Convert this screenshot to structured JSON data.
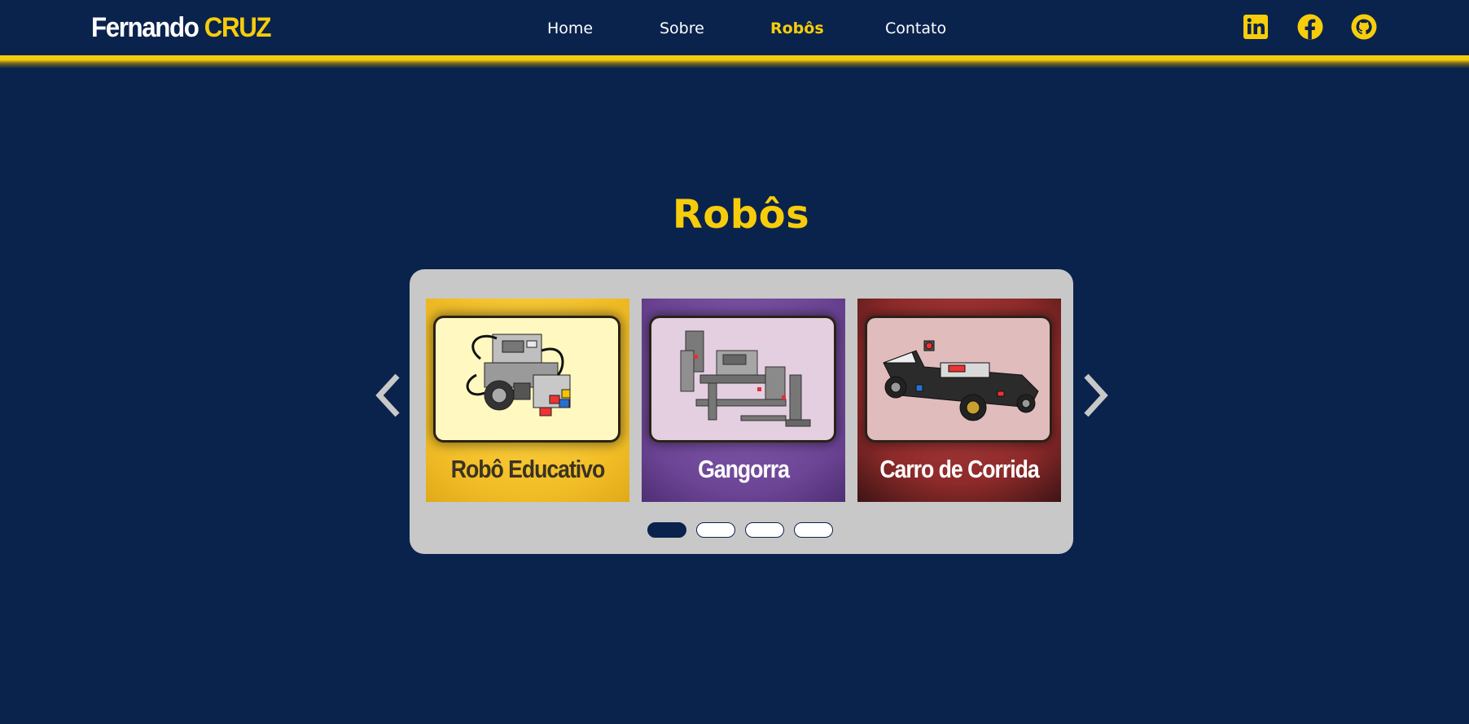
{
  "brand": {
    "first": "Fernando",
    "last": "CRUZ"
  },
  "nav": {
    "items": [
      {
        "label": "Home",
        "active": false
      },
      {
        "label": "Sobre",
        "active": false
      },
      {
        "label": "Robôs",
        "active": true
      },
      {
        "label": "Contato",
        "active": false
      }
    ]
  },
  "social": [
    {
      "icon": "linkedin-icon"
    },
    {
      "icon": "facebook-icon"
    },
    {
      "icon": "github-icon"
    }
  ],
  "section": {
    "title": "Robôs"
  },
  "carousel": {
    "cards": [
      {
        "title": "Robô Educativo",
        "theme": "yellow",
        "image_icon": "robot-image"
      },
      {
        "title": "Gangorra",
        "theme": "purple",
        "image_icon": "seesaw-robot-image"
      },
      {
        "title": "Carro de Corrida",
        "theme": "red",
        "image_icon": "race-car-image"
      }
    ],
    "prev_icon": "chevron-left-icon",
    "next_icon": "chevron-right-icon",
    "indicator_count": 4,
    "active_indicator": 1
  },
  "colors": {
    "background": "#0a234d",
    "accent": "#f7cd0b",
    "carousel_bg": "#c9c8c8"
  }
}
